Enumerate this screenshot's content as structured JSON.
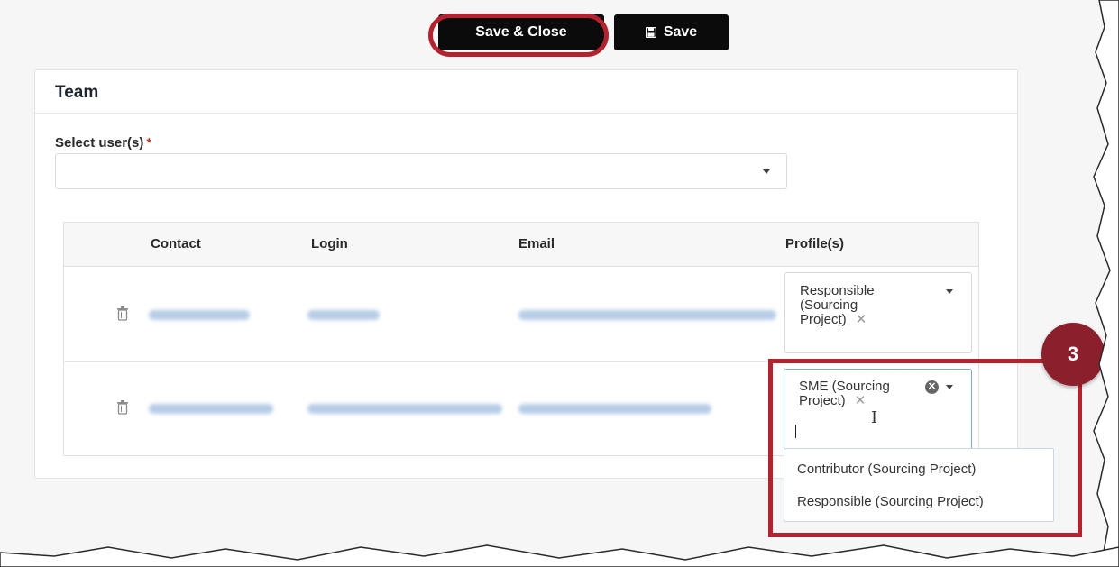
{
  "toolbar": {
    "save_close_label": "Save & Close",
    "save_label": "Save"
  },
  "panel": {
    "title": "Team",
    "select_label": "Select user(s)",
    "required_mark": "*"
  },
  "table": {
    "headers": [
      "Contact",
      "Login",
      "Email",
      "Profile(s)"
    ],
    "rows": [
      {
        "profile_tag": "Responsible (Sourcing Project)"
      },
      {
        "profile_tag": "SME (Sourcing Project)"
      }
    ]
  },
  "dropdown": {
    "options": [
      "Contributor (Sourcing Project)",
      "Responsible (Sourcing Project)"
    ]
  },
  "annotation": {
    "step_number": "3",
    "color": "#b3232f"
  },
  "colors": {
    "button_bg": "#0b0b0b",
    "accent_border": "#7ea6d6",
    "badge_bg": "#8c1f2c"
  }
}
